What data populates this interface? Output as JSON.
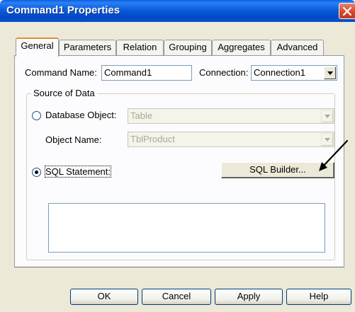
{
  "window": {
    "title": "Command1 Properties"
  },
  "tabs": [
    {
      "label": "General",
      "active": true
    },
    {
      "label": "Parameters",
      "active": false
    },
    {
      "label": "Relation",
      "active": false
    },
    {
      "label": "Grouping",
      "active": false
    },
    {
      "label": "Aggregates",
      "active": false
    },
    {
      "label": "Advanced",
      "active": false
    }
  ],
  "general": {
    "command_name_label": "Command Name:",
    "command_name_value": "Command1",
    "connection_label": "Connection:",
    "connection_value": "Connection1",
    "source_group_label": "Source of Data",
    "database_object_label": "Database Object:",
    "database_object_value": "Table",
    "object_name_label": "Object Name:",
    "object_name_value": "TblProduct",
    "sql_statement_label": "SQL Statement:",
    "sql_builder_label": "SQL Builder...",
    "sql_text": "",
    "selected_source": "SQL Statement"
  },
  "footer": {
    "ok_label": "OK",
    "cancel_label": "Cancel",
    "apply_label": "Apply",
    "help_label": "Help"
  },
  "icons": {
    "close": "close-icon",
    "dropdown": "chevron-down-icon",
    "annotation": "arrow-annotation"
  },
  "colors": {
    "titlebar": "#0a5cdc",
    "active_tab_accent": "#e68b2c",
    "dialog_bg": "#ece9d8"
  }
}
